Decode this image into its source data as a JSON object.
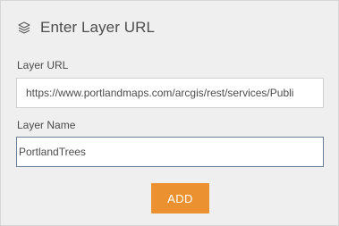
{
  "header": {
    "icon": "layers-icon",
    "title": "Enter Layer URL"
  },
  "form": {
    "url_label": "Layer URL",
    "url_value": "https://www.portlandmaps.com/arcgis/rest/services/Publi",
    "name_label": "Layer Name",
    "name_value": "PortlandTrees"
  },
  "actions": {
    "add_label": "ADD"
  },
  "colors": {
    "accent": "#ec9130",
    "panel_bg": "#efefef",
    "text": "#4c4c4c",
    "focus_border": "#6a7f96"
  }
}
